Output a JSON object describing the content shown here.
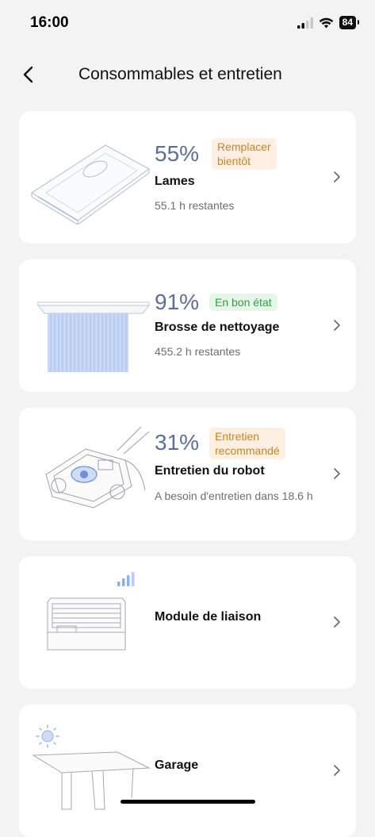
{
  "status_bar": {
    "time": "16:00",
    "battery": "84"
  },
  "nav": {
    "title": "Consommables et entretien"
  },
  "items": [
    {
      "percent": "55%",
      "badge": "Remplacer bientôt",
      "badge_lines": [
        "Remplacer",
        "bientôt"
      ],
      "badge_type": "warn",
      "name": "Lames",
      "sub": "55.1 h restantes"
    },
    {
      "percent": "91%",
      "badge": "En bon état",
      "badge_type": "good",
      "name": "Brosse de nettoyage",
      "sub": "455.2 h restantes"
    },
    {
      "percent": "31%",
      "badge": "Entretien recommandé",
      "badge_lines": [
        "Entretien",
        "recommandé"
      ],
      "badge_type": "warn",
      "name": "Entretien du robot",
      "sub": "A besoin d'entretien dans 18.6 h"
    },
    {
      "name": "Module de liaison"
    },
    {
      "name": "Garage"
    }
  ],
  "colors": {
    "percent": "#5b6f9a",
    "badge_warn_bg": "#fdf0e3",
    "badge_warn_text": "#c98426",
    "badge_good_bg": "#e6f6e8",
    "badge_good_text": "#2f9e47",
    "card": "#ffffff",
    "page": "#f3f3f3"
  },
  "icons": [
    "back-icon",
    "chevron-right-icon",
    "blade-icon",
    "brush-icon",
    "robot-icon",
    "link-module-icon",
    "garage-icon",
    "signal-icon",
    "wifi-icon"
  ]
}
